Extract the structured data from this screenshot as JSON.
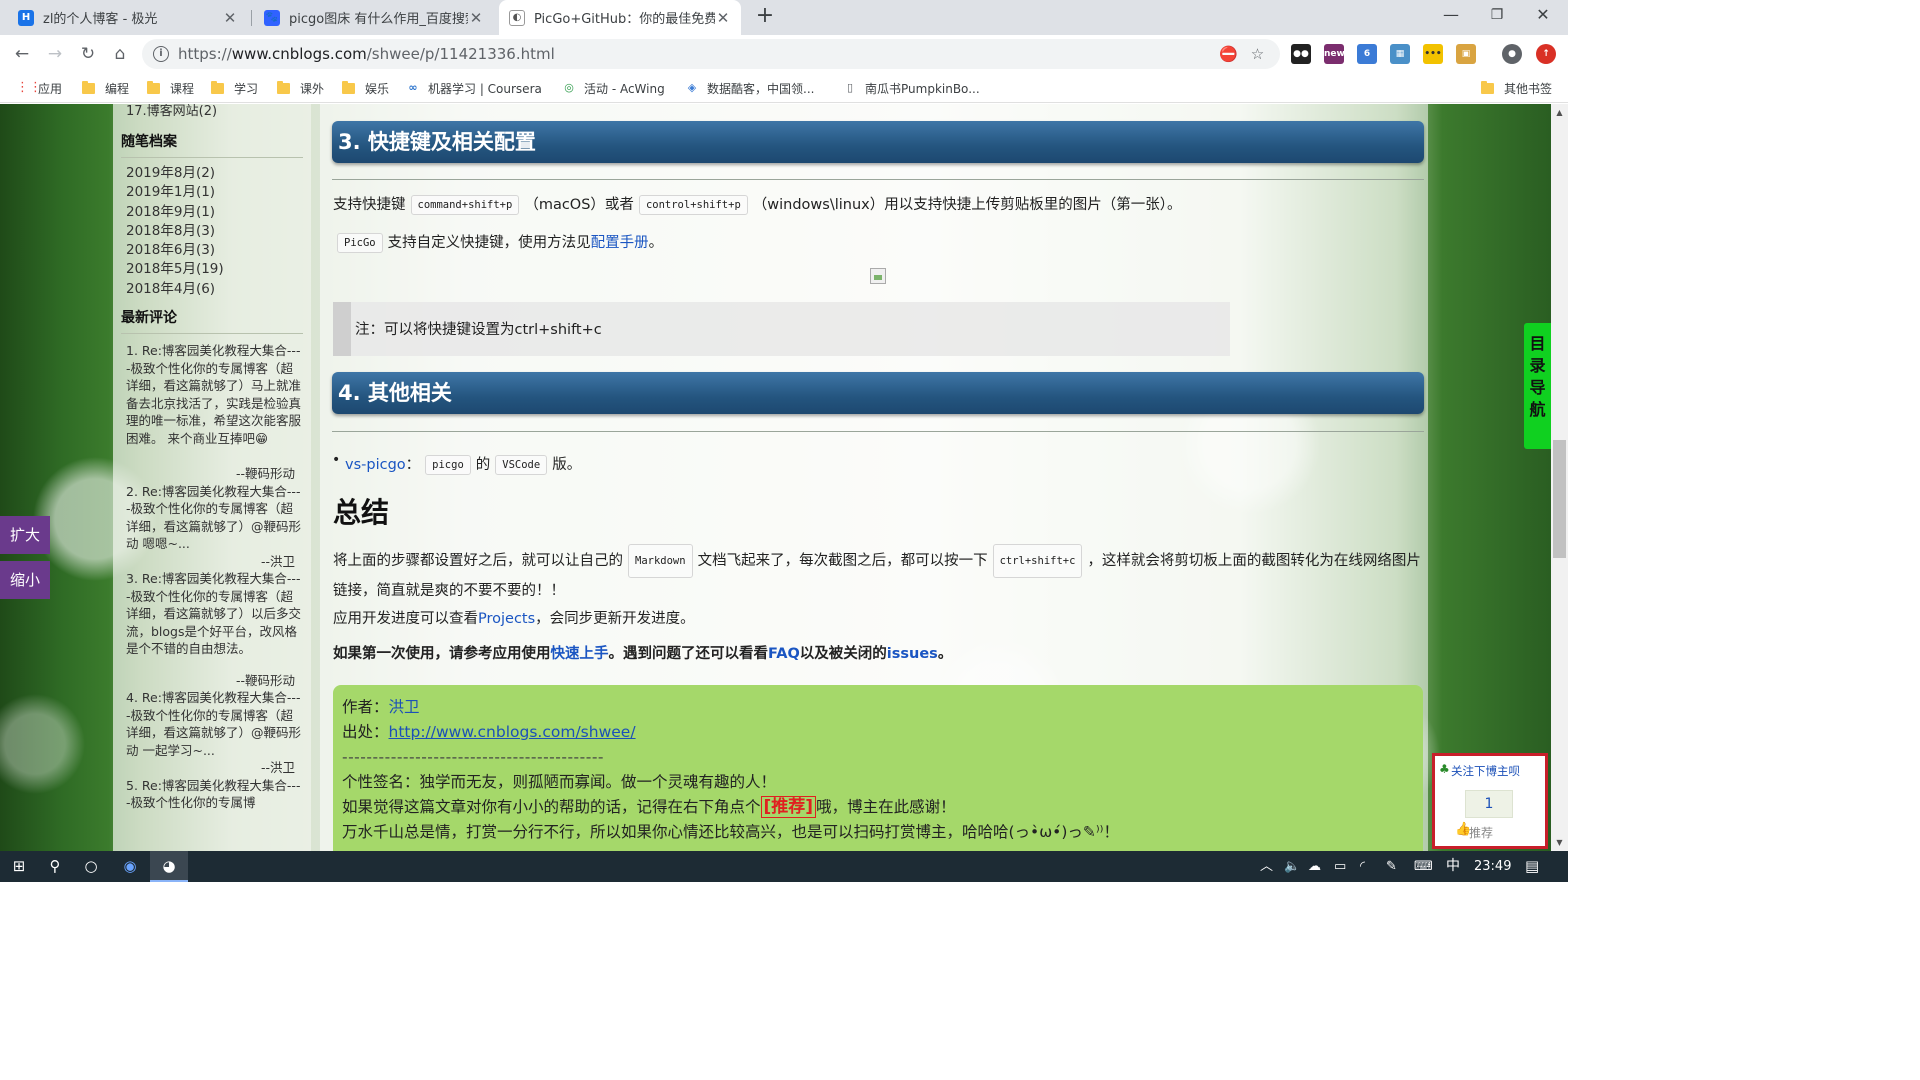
{
  "tabs": [
    {
      "title": "zl的个人博客 - 极光",
      "favicon": "H",
      "color": "#1a73e8"
    },
    {
      "title": "picgo图床 有什么作用_百度搜索",
      "favicon": "paw",
      "color": "#3062ff"
    },
    {
      "title": "PicGo+GitHub：你的最佳免费图",
      "favicon": "GH",
      "color": "#555"
    }
  ],
  "window": {
    "minimize": "—",
    "restore": "❐",
    "close": "✕"
  },
  "url": {
    "prefix": "https://",
    "host": "www.cnblogs.com",
    "path": "/shwee/p/11421336.html"
  },
  "bookmarks": [
    {
      "label": "应用",
      "icon": "apps-grid-icon"
    },
    {
      "label": "编程",
      "icon": "folder-icon"
    },
    {
      "label": "课程",
      "icon": "folder-icon"
    },
    {
      "label": "学习",
      "icon": "folder-icon"
    },
    {
      "label": "课外",
      "icon": "folder-icon"
    },
    {
      "label": "娱乐",
      "icon": "folder-icon"
    },
    {
      "label": "机器学习 | Coursera",
      "icon": "coursera-icon"
    },
    {
      "label": "活动 - AcWing",
      "icon": "acwing-icon"
    },
    {
      "label": "数据酷客，中国领...",
      "icon": "cookdata-icon"
    },
    {
      "label": "南瓜书PumpkinBo...",
      "icon": "page-icon"
    },
    {
      "label": "其他书签",
      "icon": "folder-icon"
    }
  ],
  "sidebar": {
    "cut_item": "17.博客网站(2)",
    "archive_title": "随笔档案",
    "archive": [
      "2019年8月(2)",
      "2019年1月(1)",
      "2018年9月(1)",
      "2018年8月(3)",
      "2018年6月(3)",
      "2018年5月(19)",
      "2018年4月(6)"
    ],
    "comments_title": "最新评论",
    "comments": [
      {
        "text": "1. Re:博客园美化教程大集合----极致个性化你的专属博客（超详细，看这篇就够了）马上就准备去北京找活了，实践是检验真理的唯一标准，希望这次能客服困难。 来个商业互捧吧😁",
        "author": "--鞭码形动"
      },
      {
        "text": "2. Re:博客园美化教程大集合----极致个性化你的专属博客（超详细，看这篇就够了）@鞭码形动 嗯嗯~...",
        "author": "--洪卫"
      },
      {
        "text": "3. Re:博客园美化教程大集合----极致个性化你的专属博客（超详细，看这篇就够了）以后多交流，blogs是个好平台，改风格是个不错的自由想法。",
        "author": "--鞭码形动"
      },
      {
        "text": "4. Re:博客园美化教程大集合----极致个性化你的专属博客（超详细，看这篇就够了）@鞭码形动 一起学习~...",
        "author": "--洪卫"
      },
      {
        "text": "5. Re:博客园美化教程大集合----极致个性化你的专属博",
        "author": ""
      }
    ]
  },
  "side_buttons": {
    "zoom_in": "扩大",
    "zoom_out": "缩小"
  },
  "article": {
    "sec3_title": "3. 快捷键及相关配置",
    "shortcut": {
      "t1": "支持快捷键",
      "code_mac": "command+shift+p",
      "t2": "（macOS）或者",
      "code_win": "control+shift+p",
      "t3": "（windows\\linux）用以支持快捷上传剪贴板里的图片（第一张）。"
    },
    "custom": {
      "code": "PicGo",
      "t1": "支持自定义快捷键，使用方法见",
      "link": "配置手册",
      "t2": "。"
    },
    "note": "注：可以将快捷键设置为ctrl+shift+c",
    "sec4_title": "4. 其他相关",
    "vs": {
      "link": "vs-picgo",
      "t1": "：",
      "code1": "picgo",
      "t2": "的",
      "code2": "VSCode",
      "t3": "版。"
    },
    "summary_title": "总结",
    "summary": {
      "t1": "将上面的步骤都设置好之后，就可以让自己的",
      "code1": "Markdown",
      "t2": "文档飞起来了，每次截图之后，都可以按一下",
      "code2": "ctrl+shift+c",
      "t3": "，这样就会将剪切板上面的截图转化为在线网络图片链接，简直就是爽的不要不要的！！"
    },
    "progress": {
      "t1": "应用开发进度可以查看",
      "link": "Projects",
      "t2": "，会同步更新开发进度。"
    },
    "first_use": {
      "t1": "如果第一次使用，请参考应用使用",
      "link1": "快速上手",
      "t2": "。遇到问题了还可以看看",
      "link2": "FAQ",
      "t3": "以及被关闭的",
      "link3": "issues",
      "t4": "。"
    }
  },
  "signature": {
    "author_label": "作者：",
    "author": "洪卫",
    "source_label": "出处：",
    "source": "http://www.cnblogs.com/shwee/",
    "dashes": "-------------------------------------------",
    "motto": "个性签名：独学而无友，则孤陋而寡闻。做一个灵魂有趣的人！",
    "recommend_t1": "如果觉得这篇文章对你有小小的帮助的话，记得在右下角点个",
    "recommend_badge": "[推荐]",
    "recommend_t2": "哦，博主在此感谢！",
    "donate": "万水千山总是情，打赏一分行不行，所以如果你心情还比较高兴，也是可以扫码打赏博主，哈哈哈(っ•̀ω•́)っ✎⁾⁾！"
  },
  "catalog_nav": "目录导航",
  "follow": {
    "title": "关注下博主呗",
    "count": "1",
    "recommend": "推荐"
  },
  "taskbar": {
    "ime": "中",
    "time": "23:49"
  }
}
